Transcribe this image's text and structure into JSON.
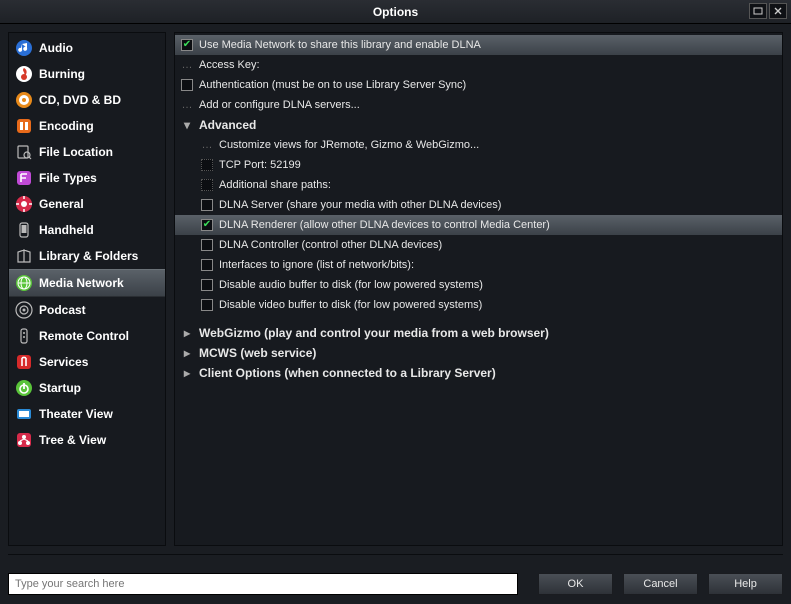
{
  "window": {
    "title": "Options"
  },
  "sidebar": {
    "items": [
      {
        "label": "Audio",
        "icon": "audio",
        "bg": "#2a6fd6"
      },
      {
        "label": "Burning",
        "icon": "burning",
        "bg": "#d63a2a"
      },
      {
        "label": "CD, DVD & BD",
        "icon": "disc",
        "bg": "#e88a1a"
      },
      {
        "label": "Encoding",
        "icon": "encoding",
        "bg": "#e86a1a"
      },
      {
        "label": "File Location",
        "icon": "filelocation",
        "bg": "#888"
      },
      {
        "label": "File Types",
        "icon": "filetypes",
        "bg": "#c04ad6"
      },
      {
        "label": "General",
        "icon": "general",
        "bg": "#d62a4a"
      },
      {
        "label": "Handheld",
        "icon": "handheld",
        "bg": "#888"
      },
      {
        "label": "Library & Folders",
        "icon": "library",
        "bg": "#888"
      },
      {
        "label": "Media Network",
        "icon": "network",
        "bg": "#5ac43a",
        "active": true
      },
      {
        "label": "Podcast",
        "icon": "podcast",
        "bg": "#888"
      },
      {
        "label": "Remote Control",
        "icon": "remote",
        "bg": "#888"
      },
      {
        "label": "Services",
        "icon": "services",
        "bg": "#d62a2a"
      },
      {
        "label": "Startup",
        "icon": "startup",
        "bg": "#5ac43a"
      },
      {
        "label": "Theater View",
        "icon": "theater",
        "bg": "#2a8ad6"
      },
      {
        "label": "Tree & View",
        "icon": "tree",
        "bg": "#d62a4a"
      }
    ]
  },
  "options": [
    {
      "indent": 0,
      "kind": "check",
      "checked": true,
      "highlight": true,
      "label": "Use Media Network to share this library and enable DLNA"
    },
    {
      "indent": 0,
      "kind": "item",
      "label": "Access Key:"
    },
    {
      "indent": 0,
      "kind": "check",
      "checked": false,
      "label": "Authentication (must be on to use Library Server Sync)"
    },
    {
      "indent": 0,
      "kind": "item",
      "label": "Add or configure DLNA servers..."
    },
    {
      "indent": 0,
      "kind": "group",
      "expanded": true,
      "label": "Advanced"
    },
    {
      "indent": 1,
      "kind": "item",
      "label": "Customize views for JRemote, Gizmo & WebGizmo..."
    },
    {
      "indent": 1,
      "kind": "field",
      "label": "TCP Port: 52199"
    },
    {
      "indent": 1,
      "kind": "field",
      "label": "Additional share paths:"
    },
    {
      "indent": 1,
      "kind": "check",
      "checked": false,
      "label": "DLNA Server (share your media with other DLNA devices)"
    },
    {
      "indent": 1,
      "kind": "check",
      "checked": true,
      "highlight": true,
      "label": "DLNA Renderer (allow other DLNA devices to control Media Center)"
    },
    {
      "indent": 1,
      "kind": "check",
      "checked": false,
      "label": "DLNA Controller (control other DLNA devices)"
    },
    {
      "indent": 1,
      "kind": "check",
      "checked": false,
      "label": "Interfaces to ignore (list of network/bits):"
    },
    {
      "indent": 1,
      "kind": "check",
      "checked": false,
      "label": "Disable audio buffer to disk (for low powered systems)"
    },
    {
      "indent": 1,
      "kind": "check",
      "checked": false,
      "label": "Disable video buffer to disk (for low powered systems)"
    },
    {
      "indent": 0,
      "kind": "group",
      "expanded": false,
      "label": "WebGizmo (play and control your media from a web browser)"
    },
    {
      "indent": 0,
      "kind": "group",
      "expanded": false,
      "label": "MCWS (web service)"
    },
    {
      "indent": 0,
      "kind": "group",
      "expanded": false,
      "label": "Client Options (when connected to a Library Server)"
    }
  ],
  "search": {
    "placeholder": "Type your search here"
  },
  "buttons": {
    "ok": "OK",
    "cancel": "Cancel",
    "help": "Help"
  }
}
